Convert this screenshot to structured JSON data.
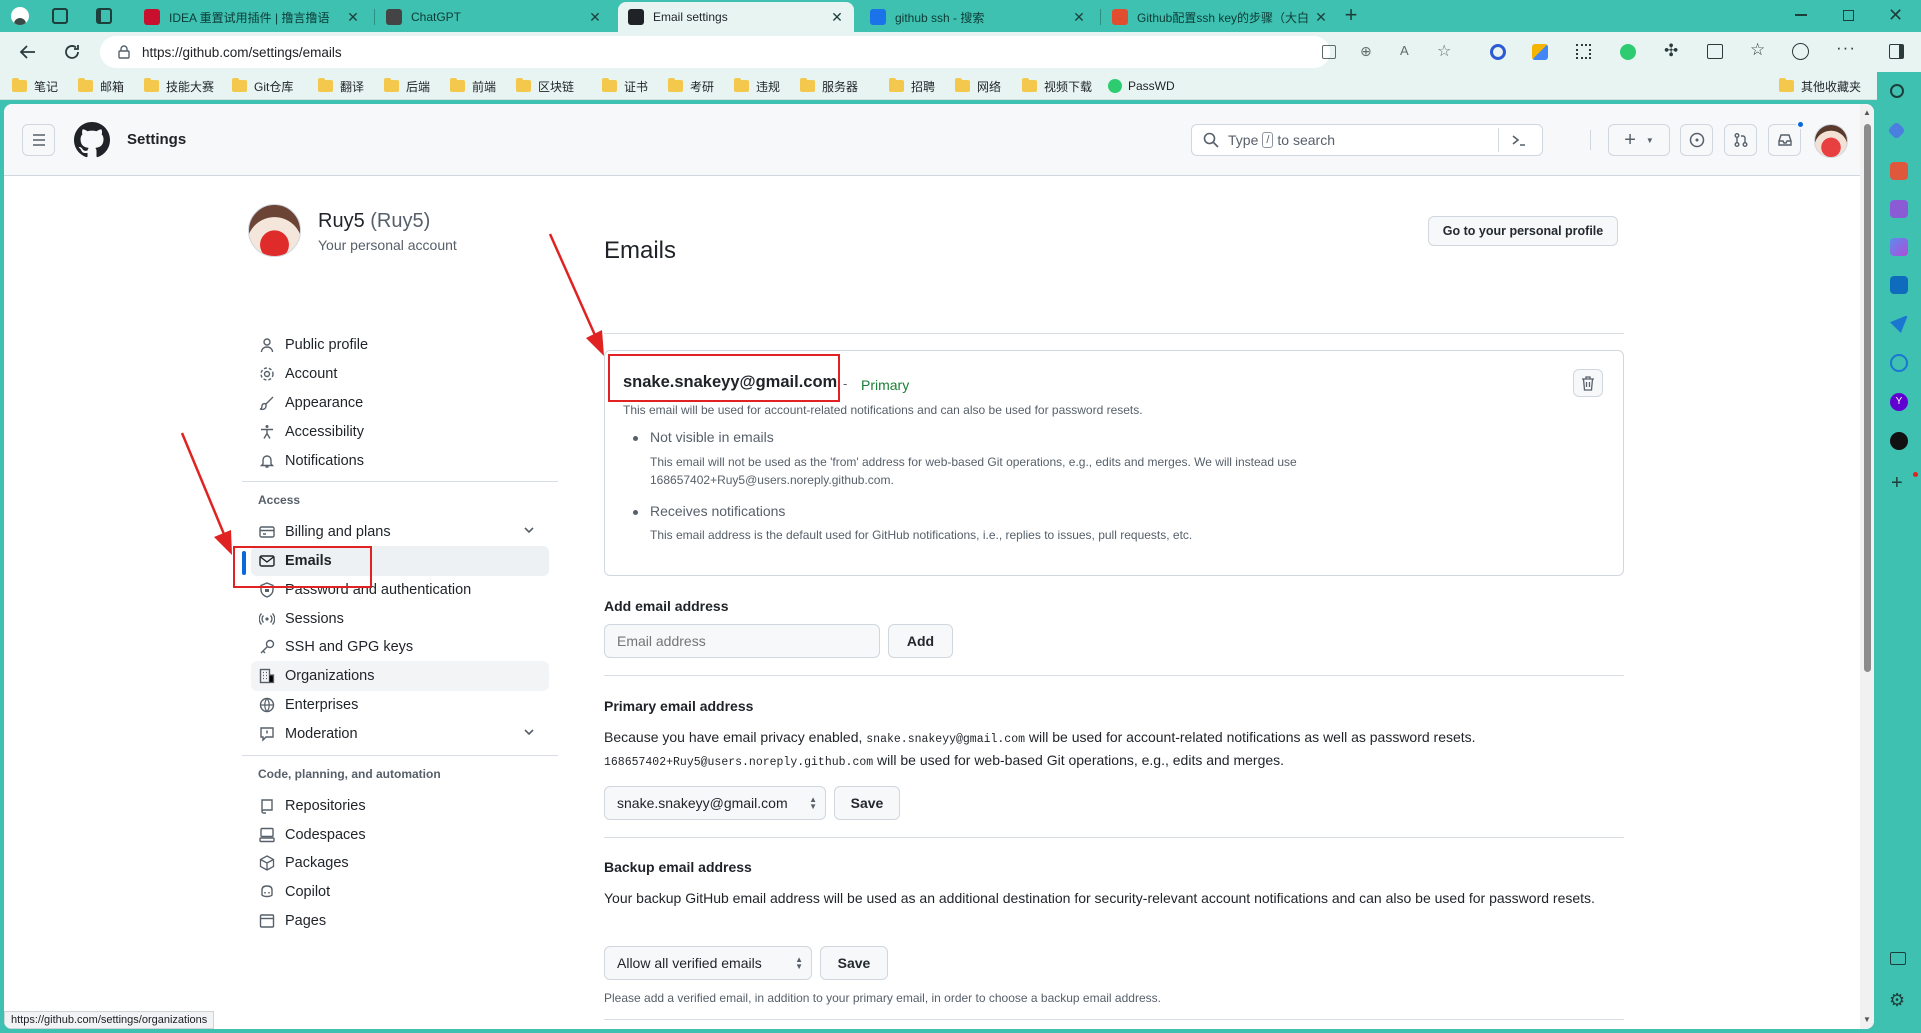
{
  "browser": {
    "tabs": [
      {
        "title": "IDEA 重置试用插件 | 撸言撸语",
        "active": false,
        "favicon_color": "#c8102e"
      },
      {
        "title": "ChatGPT",
        "active": false,
        "favicon_color": "#444444"
      },
      {
        "title": "Email settings",
        "active": true,
        "favicon_color": "#1f2328"
      },
      {
        "title": "github ssh - 搜索",
        "active": false,
        "favicon_color": "#1a73e8"
      },
      {
        "title": "Github配置ssh key的步骤（大白",
        "active": false,
        "favicon_color": "#e04d2f"
      }
    ],
    "url": "https://github.com/settings/emails",
    "bookmarks": [
      "笔记",
      "邮箱",
      "技能大赛",
      "Git仓库",
      "翻译",
      "后端",
      "前端",
      "区块链",
      "证书",
      "考研",
      "违规",
      "服务器",
      "招聘",
      "网络",
      "视频下载",
      "PassWD"
    ],
    "other_bookmarks": "其他收藏夹",
    "status_url": "https://github.com/settings/organizations"
  },
  "header": {
    "title": "Settings",
    "search_placeholder_pre": "Type",
    "search_key": "/",
    "search_placeholder_post": "to search",
    "new_label": "+"
  },
  "profile": {
    "name": "Ruy5",
    "login": "(Ruy5)",
    "subtitle": "Your personal account",
    "goto_button": "Go to your personal profile"
  },
  "sidebar": {
    "items": [
      {
        "label": "Public profile",
        "icon": "person-icon"
      },
      {
        "label": "Account",
        "icon": "gear-icon"
      },
      {
        "label": "Appearance",
        "icon": "paintbrush-icon"
      },
      {
        "label": "Accessibility",
        "icon": "accessibility-icon"
      },
      {
        "label": "Notifications",
        "icon": "bell-icon"
      }
    ],
    "access_heading": "Access",
    "access_items": [
      {
        "label": "Billing and plans",
        "icon": "credit-card-icon"
      },
      {
        "label": "Emails",
        "icon": "mail-icon"
      },
      {
        "label": "Password and authentication",
        "icon": "shield-lock-icon"
      },
      {
        "label": "Sessions",
        "icon": "broadcast-icon"
      },
      {
        "label": "SSH and GPG keys",
        "icon": "key-icon"
      },
      {
        "label": "Organizations",
        "icon": "organization-icon"
      },
      {
        "label": "Enterprises",
        "icon": "globe-icon"
      },
      {
        "label": "Moderation",
        "icon": "report-icon"
      }
    ],
    "code_heading": "Code, planning, and automation",
    "code_items": [
      {
        "label": "Repositories",
        "icon": "repo-icon"
      },
      {
        "label": "Codespaces",
        "icon": "codespaces-icon"
      },
      {
        "label": "Packages",
        "icon": "package-icon"
      },
      {
        "label": "Copilot",
        "icon": "copilot-icon"
      },
      {
        "label": "Pages",
        "icon": "browser-icon"
      }
    ]
  },
  "main": {
    "title": "Emails",
    "email_card": {
      "email": "snake.snakeyy@gmail.com",
      "dash": "-",
      "badge": "Primary",
      "description": "This email will be used for account-related notifications and can also be used for password resets.",
      "bullets": [
        {
          "title": "Not visible in emails",
          "text1": "This email will not be used as the 'from' address for web-based Git operations, e.g., edits and merges. We will instead use",
          "text2": "168657402+Ruy5@users.noreply.github.com."
        },
        {
          "title": "Receives notifications",
          "text1": "This email address is the default used for GitHub notifications, i.e., replies to issues, pull requests, etc.",
          "text2": ""
        }
      ]
    },
    "add_email": {
      "heading": "Add email address",
      "placeholder": "Email address",
      "button": "Add"
    },
    "primary_email": {
      "heading": "Primary email address",
      "line1_pre": "Because you have email privacy enabled,",
      "line1_code": "snake.snakeyy@gmail.com",
      "line1_post": "will be used for account-related notifications as well as password resets.",
      "line2_code": "168657402+Ruy5@users.noreply.github.com",
      "line2_post": "will be used for web-based Git operations, e.g., edits and merges.",
      "select_value": "snake.snakeyy@gmail.com",
      "save": "Save"
    },
    "backup_email": {
      "heading": "Backup email address",
      "text": "Your backup GitHub email address will be used as an additional destination for security-relevant account notifications and can also be used for password resets.",
      "select_value": "Allow all verified emails",
      "save": "Save",
      "note": "Please add a verified email, in addition to your primary email, in order to choose a backup email address."
    }
  },
  "colors": {
    "browser_theme": "#3fc1b1",
    "annotation_red": "#e02222",
    "primary_badge": "#1a7f37",
    "selected_bar": "#0969da"
  }
}
